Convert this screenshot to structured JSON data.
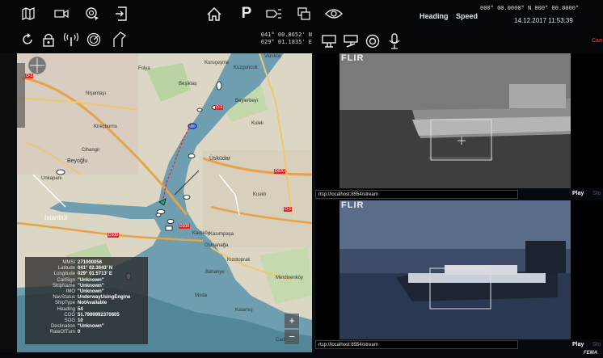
{
  "toolbar": {
    "row1_icons": [
      "map-icon",
      "camera-icon",
      "radar-search-icon",
      "exit-icon",
      "home-icon",
      "parking-icon",
      "light-signal-icon",
      "window-icon",
      "eye-icon"
    ],
    "parking_glyph": "P",
    "row2_icons": [
      "refresh-icon",
      "lock-icon",
      "antenna-icon",
      "radar-icon",
      "anchor-shape-icon"
    ],
    "camera_icons": [
      "camera-pan-icon",
      "camera-tilt-icon",
      "focus-icon",
      "microphone-icon"
    ],
    "heading_label": "Heading",
    "speed_label": "Speed",
    "coord_top": "000° 00.0000° N 000° 00.0000°",
    "datetime": "14.12.2017 11:53:39",
    "lat_readout": "041° 00.8652' N",
    "lon_readout": "029° 01.1835' E",
    "partial_right": "Can"
  },
  "map": {
    "districts": [
      "Vaniköy",
      "Fulya",
      "Beşiktaş",
      "Nişantaşı",
      "Kuzguncuk",
      "Kuruçeşme",
      "Kireçburnu",
      "Beylerbeyi",
      "Cihangir",
      "Beyoğlu",
      "Üsküdar",
      "Unkapanı",
      "Istanbul",
      "Kuleli",
      "Kısıklı",
      "Kadıköy",
      "Kasımpaşa",
      "Osmanağa",
      "Bahariye",
      "Kızıltoprak",
      "Moda",
      "Merdivenköy",
      "Kalamış",
      "Cadı"
    ],
    "road_labels": [
      "O-1",
      "O-1",
      "O-1",
      "D020",
      "D020",
      "D100",
      "D100",
      "O-1"
    ],
    "zoom_plus": "+",
    "zoom_minus": "−"
  },
  "ais_info": {
    "rows": [
      {
        "key": "MMSI",
        "value": "271000056"
      },
      {
        "key": "Latitude",
        "value": "041° 02.3643' N"
      },
      {
        "key": "Longitude",
        "value": "029° 01.5713' E"
      },
      {
        "key": "CallSign",
        "value": "\"Unknown\""
      },
      {
        "key": "ShipName",
        "value": "\"Unknown\""
      },
      {
        "key": "IMO",
        "value": "\"Unknown\""
      },
      {
        "key": "NavStatus",
        "value": "UnderwayUsingEngine"
      },
      {
        "key": "ShipType",
        "value": "NotAvailable"
      },
      {
        "key": "Heading",
        "value": "54"
      },
      {
        "key": "COG",
        "value": "51.7999992370605"
      },
      {
        "key": "SOG",
        "value": "10"
      },
      {
        "key": "Destination",
        "value": "\"Unknown\""
      },
      {
        "key": "RateOfTurn",
        "value": "0"
      }
    ]
  },
  "streams": [
    {
      "brand": "FLIR",
      "url": "rtsp://localhost:8554/stream",
      "play": "Play",
      "stop": "Sto"
    },
    {
      "brand": "FLIR",
      "url": "rtsp://localhost:8554/stream",
      "play": "Play",
      "stop": "Sto"
    }
  ],
  "footer_brand": "FEMA",
  "colors": {
    "accent_red": "#e2262b",
    "water": "#4f90a6",
    "route": "#e2262b"
  }
}
